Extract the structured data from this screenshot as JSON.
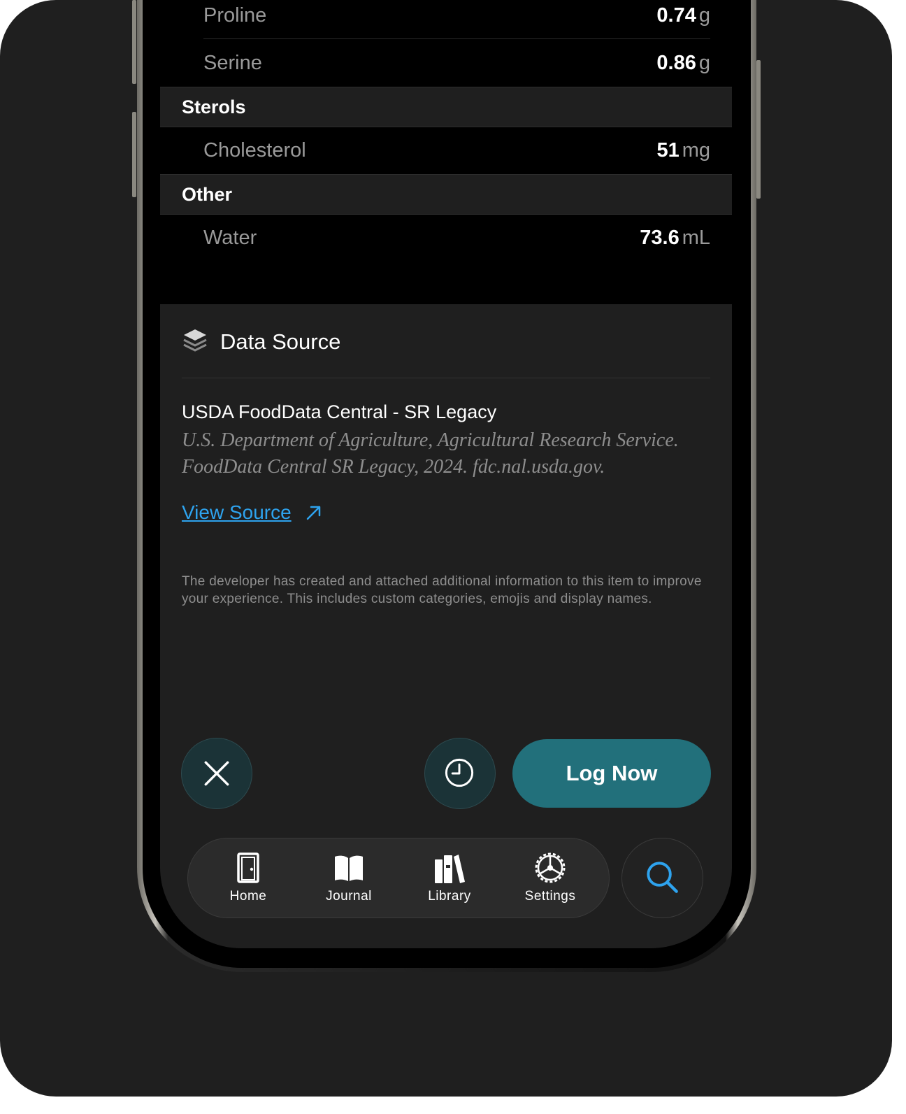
{
  "nutrients_top": [
    {
      "name": "Proline",
      "value": "0.74",
      "unit": "g"
    },
    {
      "name": "Serine",
      "value": "0.86",
      "unit": "g"
    }
  ],
  "sections": [
    {
      "title": "Sterols",
      "items": [
        {
          "name": "Cholesterol",
          "value": "51",
          "unit": "mg"
        }
      ]
    },
    {
      "title": "Other",
      "items": [
        {
          "name": "Water",
          "value": "73.6",
          "unit": "mL"
        }
      ]
    }
  ],
  "data_source": {
    "icon": "layers-icon",
    "title": "Data Source",
    "source_name": "USDA FoodData Central - SR Legacy",
    "citation": "U.S. Department of Agriculture, Agricultural Research Service. FoodData Central SR Legacy, 2024. fdc.nal.usda.gov.",
    "link_label": "View Source",
    "disclaimer": "The developer has created and attached additional information to this item to improve your experience. This includes custom categories, emojis and display names."
  },
  "actions": {
    "close_icon": "close-icon",
    "history_icon": "clock-icon",
    "log_label": "Log Now",
    "accent": "#22707b"
  },
  "tabbar": {
    "tabs": [
      {
        "label": "Home",
        "icon": "door-icon"
      },
      {
        "label": "Journal",
        "icon": "book-icon"
      },
      {
        "label": "Library",
        "icon": "books-icon"
      },
      {
        "label": "Settings",
        "icon": "gear-icon"
      }
    ],
    "search_icon": "search-icon"
  }
}
